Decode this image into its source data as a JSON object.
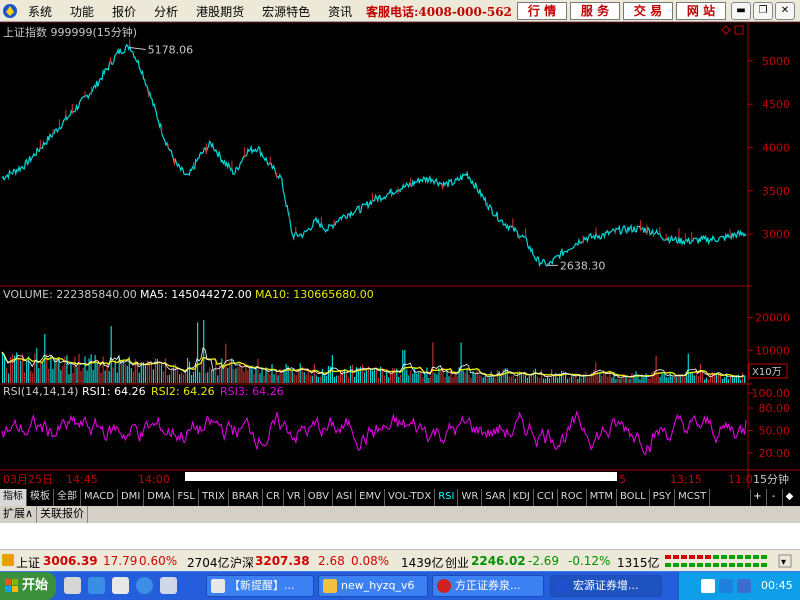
{
  "menubar": {
    "items": [
      "系统",
      "功能",
      "报价",
      "分析",
      "港股期货",
      "宏源特色",
      "资讯"
    ],
    "hotline": "客服电话:4008-000-562",
    "quick_buttons": [
      "行 情",
      "服 务",
      "交 易",
      "网 站"
    ]
  },
  "main_chart": {
    "title": "上证指数 999999(15分钟)",
    "high_label": "5178.06",
    "low_label": "2638.30",
    "y_ticks": [
      "5000",
      "4500",
      "4000",
      "3500",
      "3000"
    ]
  },
  "volume_panel": {
    "label": "VOLUME: 222385840.00",
    "ma5": "MA5: 145044272.00",
    "ma10": "MA10: 130665680.00",
    "y_ticks": [
      "20000",
      "10000"
    ],
    "unit": "X10万"
  },
  "rsi_panel": {
    "label": "RSI(14,14,14)",
    "rsi1": "RSI1: 64.26",
    "rsi2": "RSI2: 64.26",
    "rsi3": "RSI3: 64.26",
    "y_ticks": [
      "100.00",
      "80.00",
      "50.00",
      "20.00"
    ]
  },
  "time_axis": {
    "labels": [
      "03月25日",
      "14:45",
      "14:00",
      "5",
      "13:15",
      "11:0"
    ],
    "period": "15分钟"
  },
  "indicator_tabs": [
    "指标",
    "模板",
    "全部",
    "MACD",
    "DMI",
    "DMA",
    "FSL",
    "TRIX",
    "BRAR",
    "CR",
    "VR",
    "OBV",
    "ASI",
    "EMV",
    "VOL-TDX",
    "RSI",
    "WR",
    "SAR",
    "KDJ",
    "CCI",
    "ROC",
    "MTM",
    "BOLL",
    "PSY",
    "MCST"
  ],
  "active_tab": "RSI",
  "tab_controls": [
    "+",
    "-",
    "◆"
  ],
  "subbar": [
    "扩展∧",
    "关联报价"
  ],
  "ticker": {
    "sh_name": "上证",
    "sh_value": "3006.39",
    "sh_change": "17.79",
    "sh_pct": "0.60%",
    "sh_amount": "2704亿",
    "hs_name": "沪深",
    "hs_value": "3207.38",
    "hs_change": "2.68",
    "hs_pct": "0.08%",
    "hs_amount": "1439亿",
    "cy_name": "创业",
    "cy_value": "2246.02",
    "cy_change": "-2.69",
    "cy_pct": "-0.12%",
    "cy_amount": "1315亿"
  },
  "taskbar": {
    "start": "开始",
    "tasks": [
      "【新提醒】...",
      "new_hyzq_v6",
      "方正证券泉...",
      "宏源证券增..."
    ],
    "clock": "00:45"
  },
  "chart_data": {
    "type": "line",
    "price_series": {
      "name": "上证指数",
      "ylim": [
        2400,
        5450
      ],
      "points": [
        3650,
        3720,
        3800,
        3950,
        4100,
        4250,
        4400,
        4550,
        4700,
        4900,
        5100,
        5178,
        4900,
        4500,
        4100,
        3800,
        3650,
        3900,
        4050,
        3850,
        3700,
        3950,
        4000,
        3800,
        3650,
        2980,
        3000,
        3150,
        3050,
        3180,
        3250,
        3300,
        3400,
        3450,
        3520,
        3560,
        3630,
        3640,
        3570,
        3600,
        3700,
        3500,
        3300,
        3150,
        3050,
        2940,
        2700,
        2638,
        2760,
        2860,
        2950,
        2970,
        3000,
        3040,
        3060,
        3060,
        3030,
        2960,
        2930,
        2920,
        2930,
        2940,
        2950,
        2990,
        3006
      ]
    },
    "volume_series": {
      "ylim": [
        0,
        26000
      ]
    },
    "rsi_series": {
      "ylim": [
        0,
        100
      ],
      "last": 64.26
    }
  },
  "colors": {
    "price_line": "#00d8d8",
    "volume_fill": "#00d8d8",
    "volume_bar": "#c03030",
    "ma5": "#ffffff",
    "ma10": "#e8e800",
    "rsi": "#e000e0",
    "axis": "#b00000"
  }
}
